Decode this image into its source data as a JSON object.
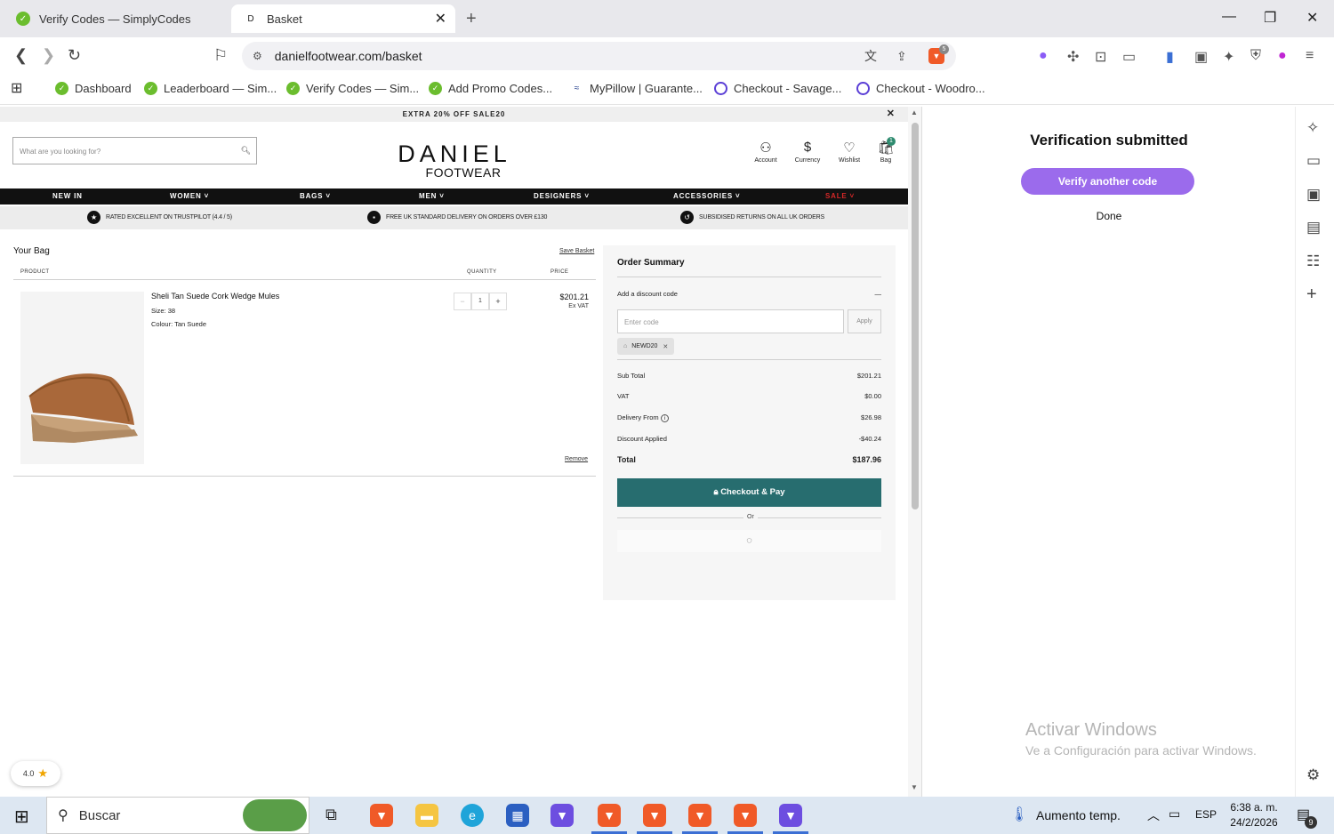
{
  "tabs": [
    {
      "title": "Verify Codes — SimplyCodes",
      "active": false
    },
    {
      "title": "Basket",
      "active": true,
      "favicon_letter": "D"
    }
  ],
  "address": {
    "url": "danielfootwear.com/basket"
  },
  "extension_badge": "5",
  "bookmarks": [
    "Dashboard",
    "Leaderboard — Sim...",
    "Verify Codes — Sim...",
    "Add Promo Codes...",
    "MyPillow | Guarante...",
    "Checkout - Savage...",
    "Checkout - Woodro..."
  ],
  "site": {
    "promo": "EXTRA 20% OFF SALE20",
    "search_placeholder": "What are you looking for?",
    "logo_line1": "DANIEL",
    "logo_line2": "FOOTWEAR",
    "header_icons": {
      "account": "Account",
      "currency": "Currency",
      "wishlist": "Wishlist",
      "bag": "Bag"
    },
    "bag_count": "1",
    "nav": [
      "NEW IN",
      "WOMEN ˅",
      "BAGS ˅",
      "MEN ˅",
      "DESIGNERS ˅",
      "ACCESSORIES ˅",
      "SALE ˅"
    ],
    "usp": [
      "RATED EXCELLENT ON TRUSTPILOT (4.4 / 5)",
      "FREE UK STANDARD DELIVERY ON ORDERS OVER £130",
      "SUBSIDISED RETURNS ON ALL UK ORDERS"
    ]
  },
  "bag": {
    "title": "Your Bag",
    "save_label": "Save Basket",
    "col_product": "PRODUCT",
    "col_quantity": "QUANTITY",
    "col_price": "PRICE",
    "item": {
      "name": "Sheli Tan Suede Cork Wedge Mules",
      "size": "Size: 38",
      "colour": "Colour: Tan Suede",
      "qty": "1",
      "price": "$201.21",
      "vat_note": "Ex VAT",
      "remove": "Remove"
    }
  },
  "summary": {
    "title": "Order Summary",
    "discount_label": "Add a discount code",
    "code_placeholder": "Enter code",
    "apply": "Apply",
    "applied_code": "NEWD20",
    "rows": [
      {
        "label": "Sub Total",
        "value": "$201.21"
      },
      {
        "label": "VAT",
        "value": "$0.00"
      },
      {
        "label": "Delivery From",
        "value": "$26.98"
      },
      {
        "label": "Discount Applied",
        "value": "-$40.24"
      }
    ],
    "total_label": "Total",
    "total_value": "$187.96",
    "checkout": "Checkout & Pay",
    "or": "Or"
  },
  "rating_widget": "4.0",
  "panel": {
    "title": "Verification submitted",
    "verify_another": "Verify another code",
    "done": "Done"
  },
  "watermark": {
    "line1": "Activar Windows",
    "line2": "Ve a Configuración para activar Windows."
  },
  "taskbar": {
    "search": "Buscar",
    "weather": "Aumento temp.",
    "lang": "ESP",
    "time": "6:38 a. m.",
    "date": "24/2/2026",
    "notifications": "9"
  },
  "colors": {
    "accent_purple": "#9b6bec",
    "checkout_teal": "#276d6f",
    "brave_orange": "#f05a28"
  }
}
